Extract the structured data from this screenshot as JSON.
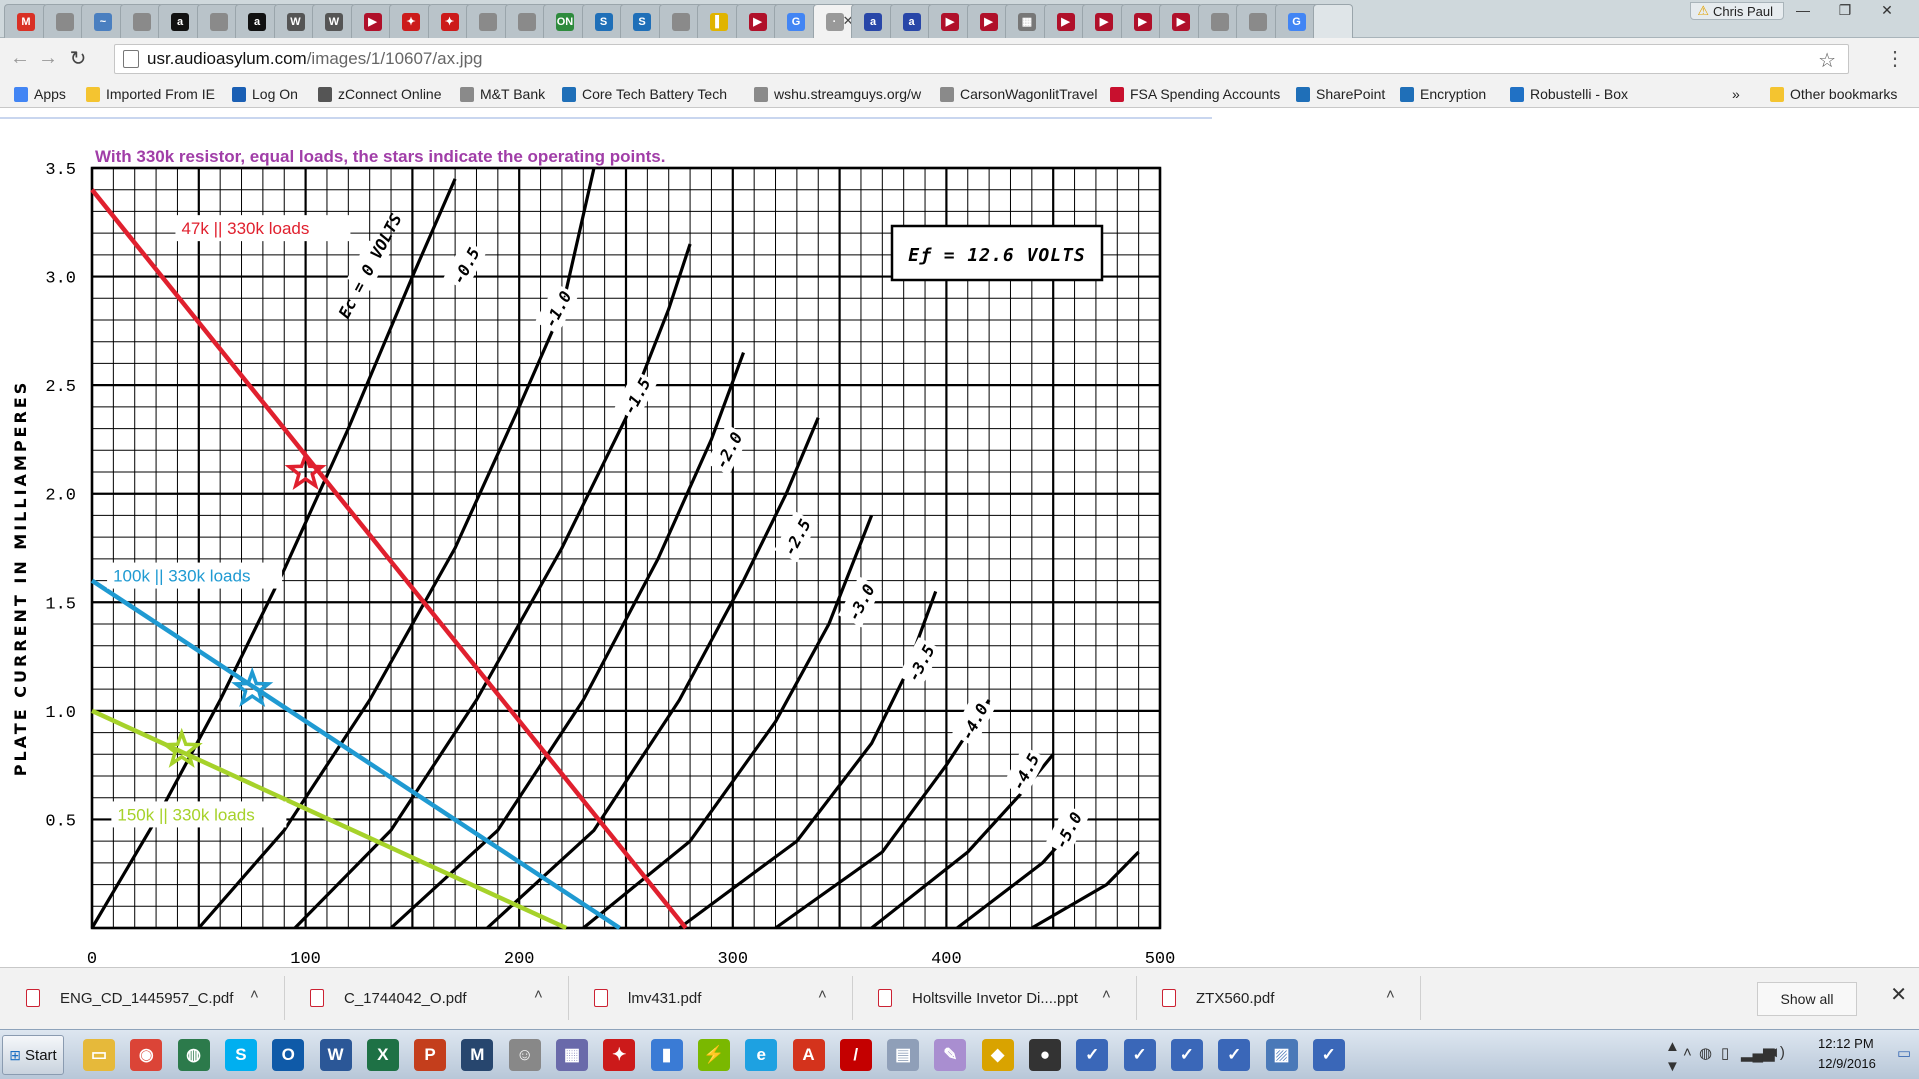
{
  "browser": {
    "tabs": [
      {
        "icon": "gmail-icon",
        "color": "#d93025",
        "glyph": "M"
      },
      {
        "icon": "page-icon",
        "color": "#8a8a8a",
        "glyph": ""
      },
      {
        "icon": "globe-icon",
        "color": "#4a7fc0",
        "glyph": "~"
      },
      {
        "icon": "page-icon",
        "color": "#8a8a8a",
        "glyph": ""
      },
      {
        "icon": "amazon-icon",
        "color": "#111111",
        "glyph": "a"
      },
      {
        "icon": "page-icon",
        "color": "#8a8a8a",
        "glyph": ""
      },
      {
        "icon": "amazon-icon",
        "color": "#111111",
        "glyph": "a"
      },
      {
        "icon": "wikipedia-icon",
        "color": "#555555",
        "glyph": "W"
      },
      {
        "icon": "wikipedia-icon",
        "color": "#555555",
        "glyph": "W"
      },
      {
        "icon": "youtube-icon",
        "color": "#b0102a",
        "glyph": "▶"
      },
      {
        "icon": "ti-icon",
        "color": "#cc1a1a",
        "glyph": "✦"
      },
      {
        "icon": "ti-icon",
        "color": "#cc1a1a",
        "glyph": "✦"
      },
      {
        "icon": "page-icon",
        "color": "#8a8a8a",
        "glyph": ""
      },
      {
        "icon": "page-icon",
        "color": "#8a8a8a",
        "glyph": ""
      },
      {
        "icon": "on-semi-icon",
        "color": "#2e8b3d",
        "glyph": "ON"
      },
      {
        "icon": "sharepoint-icon",
        "color": "#1f6fb8",
        "glyph": "S"
      },
      {
        "icon": "sharepoint-icon",
        "color": "#1f6fb8",
        "glyph": "S"
      },
      {
        "icon": "page-icon",
        "color": "#8a8a8a",
        "glyph": ""
      },
      {
        "icon": "book-icon",
        "color": "#e0b400",
        "glyph": "▌"
      },
      {
        "icon": "youtube-icon",
        "color": "#b0102a",
        "glyph": "▶"
      },
      {
        "icon": "google-icon",
        "color": "#4285f4",
        "glyph": "G"
      },
      {
        "icon": "image-tab-icon",
        "color": "#999999",
        "glyph": "·"
      },
      {
        "icon": "audio-icon",
        "color": "#2846a8",
        "glyph": "a"
      },
      {
        "icon": "audio-icon",
        "color": "#2846a8",
        "glyph": "a"
      },
      {
        "icon": "youtube-icon",
        "color": "#b0102a",
        "glyph": "▶"
      },
      {
        "icon": "youtube-icon",
        "color": "#b0102a",
        "glyph": "▶"
      },
      {
        "icon": "calendar-icon",
        "color": "#777777",
        "glyph": "▦"
      },
      {
        "icon": "youtube-icon",
        "color": "#b0102a",
        "glyph": "▶"
      },
      {
        "icon": "youtube-icon",
        "color": "#b0102a",
        "glyph": "▶"
      },
      {
        "icon": "youtube-icon",
        "color": "#b0102a",
        "glyph": "▶"
      },
      {
        "icon": "youtube-icon",
        "color": "#b0102a",
        "glyph": "▶"
      },
      {
        "icon": "page-icon",
        "color": "#8a8a8a",
        "glyph": ""
      },
      {
        "icon": "page-icon",
        "color": "#8a8a8a",
        "glyph": ""
      },
      {
        "icon": "google-icon",
        "color": "#4285f4",
        "glyph": "G"
      }
    ],
    "active_tab_index": 21,
    "user_name": "Chris Paul",
    "url_host": "usr.audioasylum.com",
    "url_path": "/images/1/10607/ax.jpg"
  },
  "bookmarks": {
    "items": [
      {
        "label": "Apps",
        "icon": "apps-grid-icon",
        "color": "#4285f4"
      },
      {
        "label": "Imported From IE",
        "icon": "folder-icon",
        "color": "#f4c430"
      },
      {
        "label": "Log On",
        "icon": "logon-icon",
        "color": "#1a5fb4"
      },
      {
        "label": "zConnect Online",
        "icon": "zconnect-icon",
        "color": "#555555"
      },
      {
        "label": "M&T Bank",
        "icon": "page-icon",
        "color": "#8a8a8a"
      },
      {
        "label": "Core Tech Battery Tech",
        "icon": "sharepoint-icon",
        "color": "#1f6fb8"
      },
      {
        "label": "wshu.streamguys.org/w",
        "icon": "page-icon",
        "color": "#8a8a8a"
      },
      {
        "label": "CarsonWagonlitTravel",
        "icon": "page-icon",
        "color": "#8a8a8a"
      },
      {
        "label": "FSA Spending Accounts",
        "icon": "fsa-icon",
        "color": "#c8102e"
      },
      {
        "label": "SharePoint",
        "icon": "sharepoint-icon",
        "color": "#1f6fb8"
      },
      {
        "label": "Encryption",
        "icon": "sharepoint-icon",
        "color": "#1f6fb8"
      },
      {
        "label": "Robustelli - Box",
        "icon": "box-icon",
        "color": "#2071c5"
      }
    ],
    "overflow": "»",
    "other": "Other bookmarks"
  },
  "chart": {
    "annotation_title": "With 330k resistor, equal loads, the stars indicate the operating points.",
    "ylabel": "PLATE CURRENT IN MILLIAMPERES",
    "ef_label": "Eƒ = 12.6 VOLTS",
    "colors": {
      "red": "#e0202e",
      "blue": "#1f9ad2",
      "green": "#a6d22a",
      "title": "#a13ea8"
    }
  },
  "chart_data": {
    "type": "line",
    "title": "With 330k resistor, equal loads, the stars indicate the operating points.",
    "xlabel": "",
    "ylabel": "PLATE CURRENT IN MILLIAMPERES",
    "xlim": [
      0,
      500
    ],
    "ylim": [
      0,
      3.5
    ],
    "x_ticks": [
      "0",
      "100",
      "200",
      "300",
      "400",
      "500"
    ],
    "y_ticks": [
      "0.5",
      "1.0",
      "1.5",
      "2.0",
      "2.5",
      "3.0",
      "3.5"
    ],
    "grid": true,
    "curves": [
      {
        "label": "Ec = 0 VOLTS",
        "points": [
          [
            0,
            0
          ],
          [
            30,
            0.5
          ],
          [
            60,
            1.05
          ],
          [
            90,
            1.65
          ],
          [
            120,
            2.3
          ],
          [
            150,
            3.0
          ],
          [
            170,
            3.45
          ]
        ],
        "label_pos": [
          130,
          3.05
        ]
      },
      {
        "label": "-0.5",
        "points": [
          [
            50,
            0
          ],
          [
            90,
            0.45
          ],
          [
            130,
            1.05
          ],
          [
            170,
            1.75
          ],
          [
            200,
            2.4
          ],
          [
            220,
            2.85
          ],
          [
            235,
            3.5
          ]
        ],
        "label_pos": [
          175,
          3.05
        ]
      },
      {
        "label": "-1.0",
        "points": [
          [
            95,
            0
          ],
          [
            140,
            0.45
          ],
          [
            180,
            1.05
          ],
          [
            220,
            1.75
          ],
          [
            250,
            2.35
          ],
          [
            270,
            2.85
          ],
          [
            280,
            3.15
          ]
        ],
        "label_pos": [
          218,
          2.85
        ]
      },
      {
        "label": "-1.5",
        "points": [
          [
            140,
            0
          ],
          [
            190,
            0.45
          ],
          [
            230,
            1.05
          ],
          [
            265,
            1.7
          ],
          [
            290,
            2.25
          ],
          [
            305,
            2.65
          ]
        ],
        "label_pos": [
          255,
          2.45
        ]
      },
      {
        "label": "-2.0",
        "points": [
          [
            185,
            0
          ],
          [
            235,
            0.45
          ],
          [
            275,
            1.05
          ],
          [
            305,
            1.6
          ],
          [
            325,
            2.0
          ],
          [
            340,
            2.35
          ]
        ],
        "label_pos": [
          298,
          2.2
        ]
      },
      {
        "label": "-2.5",
        "points": [
          [
            230,
            0
          ],
          [
            280,
            0.4
          ],
          [
            320,
            0.95
          ],
          [
            345,
            1.4
          ],
          [
            365,
            1.9
          ]
        ],
        "label_pos": [
          330,
          1.8
        ]
      },
      {
        "label": "-3.0",
        "points": [
          [
            275,
            0
          ],
          [
            330,
            0.4
          ],
          [
            365,
            0.85
          ],
          [
            380,
            1.15
          ],
          [
            395,
            1.55
          ]
        ],
        "label_pos": [
          360,
          1.5
        ]
      },
      {
        "label": "-3.5",
        "points": [
          [
            320,
            0
          ],
          [
            370,
            0.35
          ],
          [
            400,
            0.75
          ],
          [
            420,
            1.05
          ]
        ],
        "label_pos": [
          388,
          1.22
        ]
      },
      {
        "label": "-4.0",
        "points": [
          [
            365,
            0
          ],
          [
            410,
            0.35
          ],
          [
            435,
            0.62
          ],
          [
            450,
            0.8
          ]
        ],
        "label_pos": [
          413,
          0.95
        ]
      },
      {
        "label": "-4.5",
        "points": [
          [
            405,
            0
          ],
          [
            445,
            0.3
          ],
          [
            465,
            0.52
          ]
        ],
        "label_pos": [
          437,
          0.72
        ]
      },
      {
        "label": "-5.0",
        "points": [
          [
            440,
            0
          ],
          [
            475,
            0.2
          ],
          [
            490,
            0.35
          ]
        ],
        "label_pos": [
          457,
          0.45
        ]
      }
    ],
    "series": [
      {
        "name": "47k || 330k loads",
        "color": "#e0202e",
        "points": [
          [
            0,
            3.4
          ],
          [
            278,
            0
          ]
        ],
        "operating_point": [
          100,
          2.1
        ],
        "label_pos": [
          40,
          3.2
        ]
      },
      {
        "name": "100k || 330k loads",
        "color": "#1f9ad2",
        "points": [
          [
            0,
            1.6
          ],
          [
            247,
            0
          ]
        ],
        "operating_point": [
          75,
          1.1
        ],
        "label_pos": [
          8,
          1.6
        ]
      },
      {
        "name": "150k || 330k loads",
        "color": "#a6d22a",
        "points": [
          [
            0,
            1.0
          ],
          [
            222,
            0
          ]
        ],
        "operating_point": [
          42,
          0.82
        ],
        "label_pos": [
          10,
          0.5
        ]
      }
    ]
  },
  "downloads": {
    "items": [
      {
        "name": "ENG_CD_1445957_C.pdf"
      },
      {
        "name": "C_1744042_O.pdf"
      },
      {
        "name": "lmv431.pdf"
      },
      {
        "name": "Holtsville Invetor Di....ppt"
      },
      {
        "name": "ZTX560.pdf"
      }
    ],
    "show_all": "Show all"
  },
  "taskbar": {
    "start_label": "Start",
    "apps": [
      {
        "icon": "file-explorer-icon",
        "color": "#e6b93a",
        "glyph": "▭"
      },
      {
        "icon": "chrome-icon",
        "color": "#db4437",
        "glyph": "◉"
      },
      {
        "icon": "network-globe-icon",
        "color": "#2c7a4b",
        "glyph": "◍"
      },
      {
        "icon": "skype-icon",
        "color": "#00aff0",
        "glyph": "S"
      },
      {
        "icon": "outlook-icon",
        "color": "#0f5aa8",
        "glyph": "O"
      },
      {
        "icon": "word-icon",
        "color": "#2b5797",
        "glyph": "W"
      },
      {
        "icon": "excel-icon",
        "color": "#1e7145",
        "glyph": "X"
      },
      {
        "icon": "powerpoint-icon",
        "color": "#c43e1c",
        "glyph": "P"
      },
      {
        "icon": "mathcad-icon",
        "color": "#27466e",
        "glyph": "M"
      },
      {
        "icon": "cat-app-icon",
        "color": "#888888",
        "glyph": "☺"
      },
      {
        "icon": "calendar-app-icon",
        "color": "#6a6aaa",
        "glyph": "▦"
      },
      {
        "icon": "ti-icon",
        "color": "#cc1a1a",
        "glyph": "✦"
      },
      {
        "icon": "book-app-icon",
        "color": "#3a7bd5",
        "glyph": "▮"
      },
      {
        "icon": "power-tool-icon",
        "color": "#7ab800",
        "glyph": "⚡"
      },
      {
        "icon": "internet-explorer-icon",
        "color": "#1ea1e1",
        "glyph": "e"
      },
      {
        "icon": "acrobat-icon",
        "color": "#d4331c",
        "glyph": "A"
      },
      {
        "icon": "pdf-tool-icon",
        "color": "#c40000",
        "glyph": "/"
      },
      {
        "icon": "calculator-icon",
        "color": "#8f9fb8",
        "glyph": "▤"
      },
      {
        "icon": "paint-icon",
        "color": "#a98ed0",
        "glyph": "✎"
      },
      {
        "icon": "shield-icon",
        "color": "#d9a300",
        "glyph": "◆"
      },
      {
        "icon": "media-player-icon",
        "color": "#333333",
        "glyph": "●"
      },
      {
        "icon": "chart-tool-icon",
        "color": "#3a67b8",
        "glyph": "✓"
      },
      {
        "icon": "chart-tool-icon",
        "color": "#3a67b8",
        "glyph": "✓"
      },
      {
        "icon": "chart-tool-icon",
        "color": "#3a67b8",
        "glyph": "✓"
      },
      {
        "icon": "chart-tool-icon",
        "color": "#3a67b8",
        "glyph": "✓"
      },
      {
        "icon": "picture-viewer-icon",
        "color": "#4a79b8",
        "glyph": "▨"
      },
      {
        "icon": "chart-tool-icon",
        "color": "#3a67b8",
        "glyph": "✓"
      }
    ],
    "clock_time": "12:12 PM",
    "clock_date": "12/9/2016"
  }
}
